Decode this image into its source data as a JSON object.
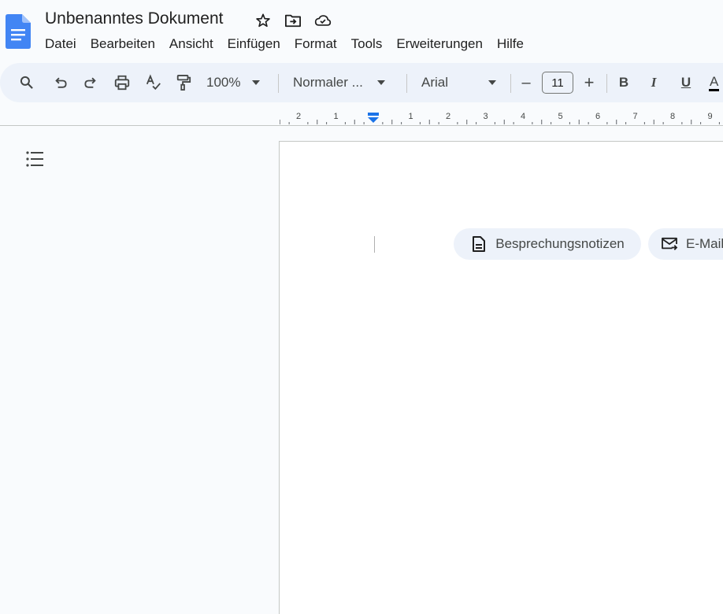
{
  "document": {
    "title": "Unbenanntes Dokument"
  },
  "menu": [
    "Datei",
    "Bearbeiten",
    "Ansicht",
    "Einfügen",
    "Format",
    "Tools",
    "Erweiterungen",
    "Hilfe"
  ],
  "toolbar": {
    "zoom": "100%",
    "style": "Normaler ...",
    "font": "Arial",
    "font_size": "11",
    "bold": "B",
    "italic": "I",
    "underline": "U",
    "text_color": "A",
    "minus": "–",
    "plus": "+"
  },
  "ruler": {
    "labels_left": [
      "2",
      "1"
    ],
    "labels_right": [
      "1",
      "2",
      "3",
      "4",
      "5",
      "6",
      "7",
      "8",
      "9"
    ]
  },
  "chips": {
    "meeting_notes": "Besprechungsnotizen",
    "email": "E-Mail"
  },
  "colors": {
    "brand": "#4285f4",
    "indent_marker": "#1a73e8",
    "toolbar_bg": "#edf2fa"
  }
}
